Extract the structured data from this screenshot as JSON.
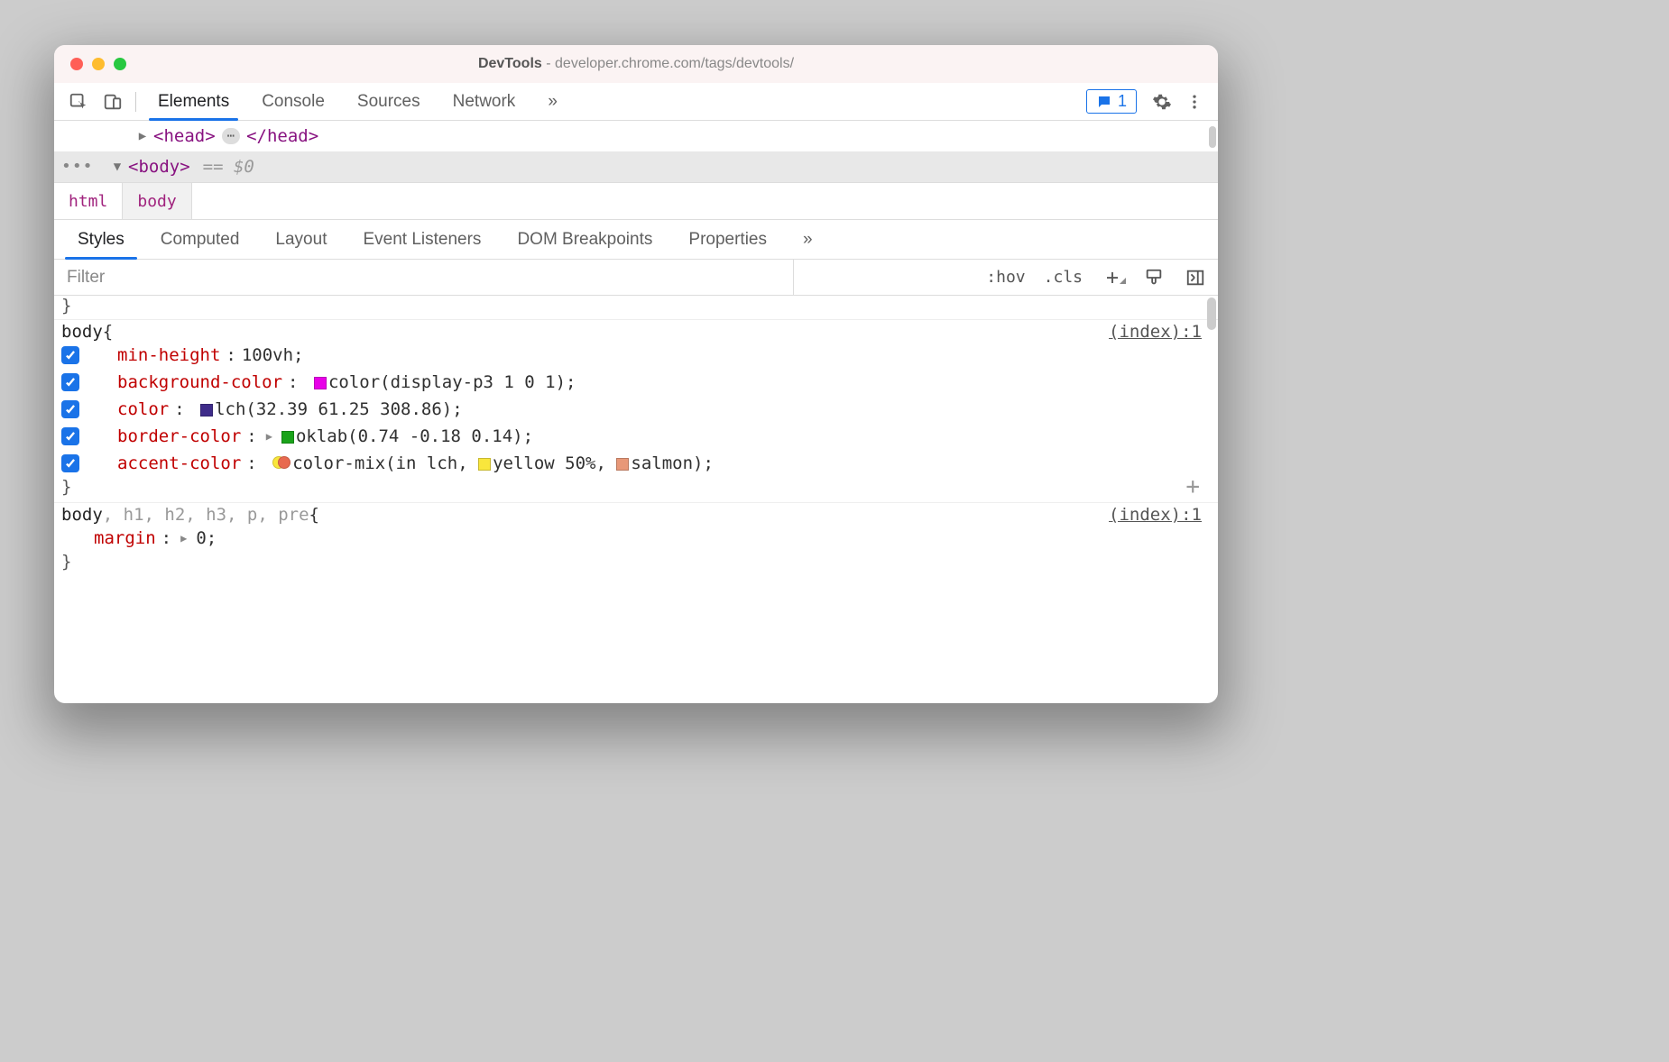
{
  "titlebar": {
    "app": "DevTools",
    "url": "developer.chrome.com/tags/devtools/"
  },
  "main_tabs": [
    "Elements",
    "Console",
    "Sources",
    "Network"
  ],
  "main_tabs_overflow": "»",
  "issues_count": "1",
  "dom": {
    "row1_open": "<head>",
    "row1_close": "</head>",
    "row1_ellipsis": "⋯",
    "row2_tag": "<body>",
    "row2_eq": "== ",
    "row2_var": "$0",
    "dots": "•••"
  },
  "crumbs": [
    "html",
    "body"
  ],
  "sub_tabs": [
    "Styles",
    "Computed",
    "Layout",
    "Event Listeners",
    "DOM Breakpoints",
    "Properties"
  ],
  "sub_tabs_overflow": "»",
  "filter": {
    "placeholder": "Filter",
    "hov": ":hov",
    "cls": ".cls"
  },
  "styles": {
    "stray_close": "}",
    "rule1": {
      "selector": "body",
      "brace": " {",
      "source": "(index):1",
      "decls": [
        {
          "prop": "min-height",
          "colon": ":",
          "pre": "",
          "swatch": null,
          "val": " 100vh;"
        },
        {
          "prop": "background-color",
          "colon": ":",
          "pre": " ",
          "swatch": "#e800e8",
          "val": "color(display-p3 1 0 1);"
        },
        {
          "prop": "color",
          "colon": ":",
          "pre": " ",
          "swatch": "#3f2c8a",
          "val": "lch(32.39 61.25 308.86);"
        },
        {
          "prop": "border-color",
          "colon": ":",
          "pre": "",
          "tri": true,
          "swatch": "#1aa31a",
          "val": "oklab(0.74 -0.18 0.14);"
        },
        {
          "prop": "accent-color",
          "colon": ":",
          "pre": " ",
          "mix": true,
          "val_parts": {
            "a": "color-mix(in lch, ",
            "sw1": "#f9e63c",
            "t1": "yellow 50%, ",
            "sw2": "#e89878",
            "t2": "salmon);"
          }
        }
      ],
      "close": "}"
    },
    "rule2": {
      "selector_main": "body",
      "selector_rest": ", h1, h2, h3, p, pre",
      "brace": " {",
      "source": "(index):1",
      "decl": {
        "prop": "margin",
        "colon": ":",
        "tri": true,
        "val": " 0;"
      },
      "close": "}"
    }
  }
}
